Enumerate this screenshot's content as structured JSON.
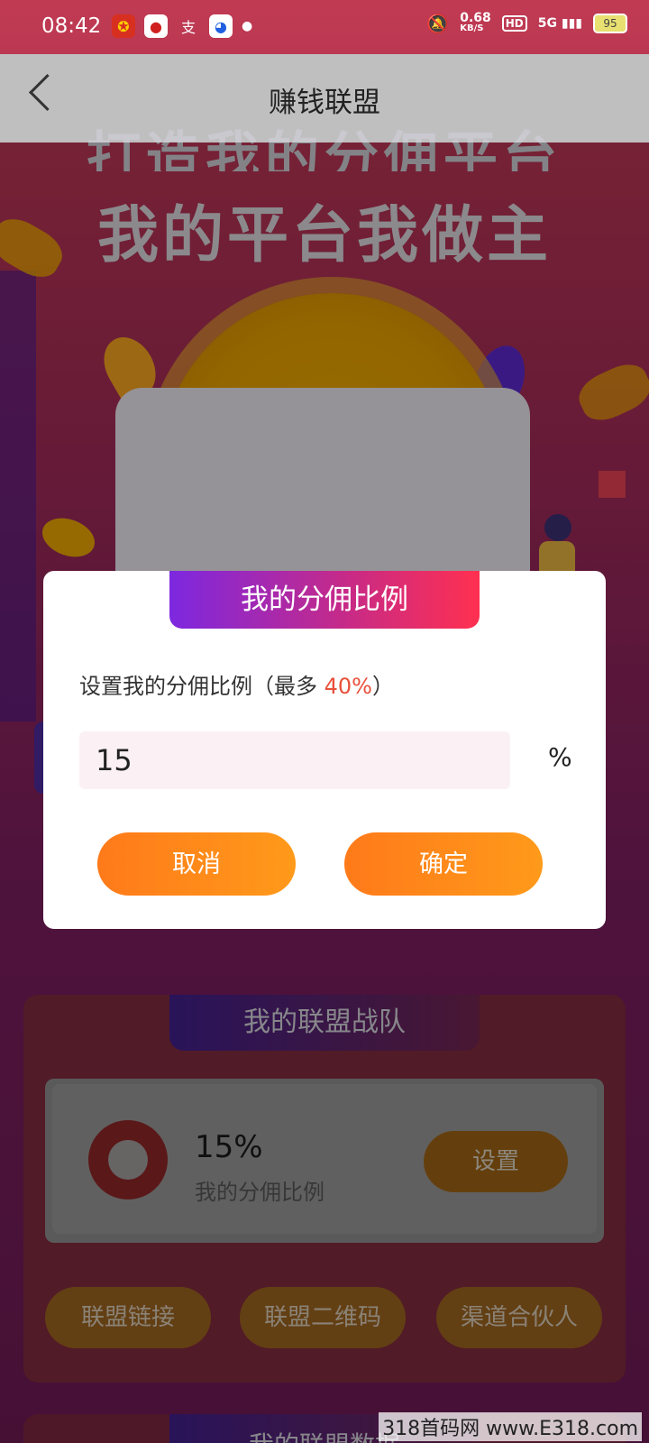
{
  "status_bar": {
    "time": "08:42",
    "net_speed": "0.68",
    "net_unit": "KB/S",
    "hd": "HD",
    "signal": "5G",
    "battery": "95"
  },
  "header": {
    "title": "赚钱联盟"
  },
  "banner": {
    "line1": "打造我的分佣平台",
    "line2": "我的平台我做主",
    "coin_symbol": "¥"
  },
  "dialog": {
    "title": "我的分佣比例",
    "prompt_prefix": "设置我的分佣比例（最多 ",
    "prompt_max": "40%",
    "prompt_suffix": "）",
    "input_value": "15",
    "unit": "%",
    "cancel_label": "取消",
    "confirm_label": "确定"
  },
  "team": {
    "title": "我的联盟战队",
    "ratio_value": "15%",
    "ratio_label": "我的分佣比例",
    "set_label": "设置",
    "buttons": [
      "联盟链接",
      "联盟二维码",
      "渠道合伙人"
    ]
  },
  "bottom_section": {
    "title": "我的联盟数据"
  },
  "watermark": "318首码网 www.E318.com",
  "colors": {
    "accent_orange": "#ff8a1a",
    "max_red": "#e8503a",
    "tab_gradient_start": "#7d28e0",
    "tab_gradient_end": "#ff3050"
  }
}
